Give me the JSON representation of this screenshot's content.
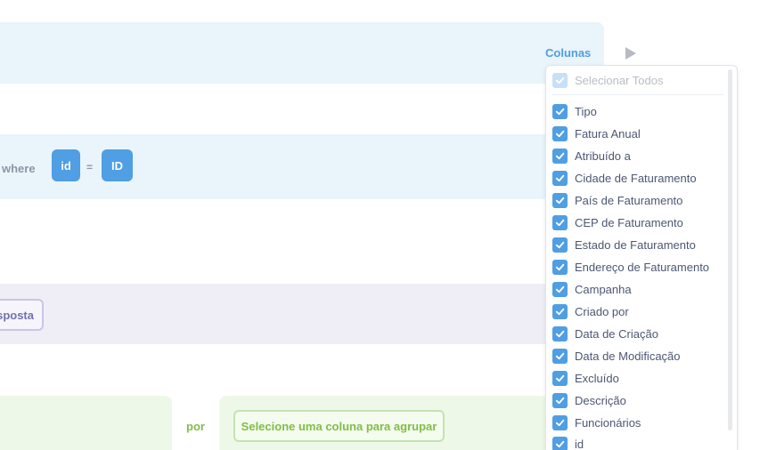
{
  "header": {
    "columns_label": "Colunas"
  },
  "join": {
    "where_label": "where",
    "left_field": "id",
    "operator": "=",
    "right_field": "ID"
  },
  "custom": {
    "partial_label": "sposta"
  },
  "summarize": {
    "by_label": "por",
    "group_placeholder": "Selecione uma coluna para agrupar"
  },
  "column_picker": {
    "select_all_label": "Selecionar Todos",
    "items": [
      {
        "label": "Tipo",
        "checked": true
      },
      {
        "label": "Fatura Anual",
        "checked": true
      },
      {
        "label": "Atribuído a",
        "checked": true
      },
      {
        "label": "Cidade de Faturamento",
        "checked": true
      },
      {
        "label": "País de Faturamento",
        "checked": true
      },
      {
        "label": "CEP de Faturamento",
        "checked": true
      },
      {
        "label": "Estado de Faturamento",
        "checked": true
      },
      {
        "label": "Endereço de Faturamento",
        "checked": true
      },
      {
        "label": "Campanha",
        "checked": true
      },
      {
        "label": "Criado por",
        "checked": true
      },
      {
        "label": "Data de Criação",
        "checked": true
      },
      {
        "label": "Data de Modificação",
        "checked": true
      },
      {
        "label": "Excluído",
        "checked": true
      },
      {
        "label": "Descrição",
        "checked": true
      },
      {
        "label": "Funcionários",
        "checked": true
      },
      {
        "label": "id",
        "checked": true
      }
    ]
  },
  "colors": {
    "accent": "#509ee3",
    "purple": "#7172ad",
    "green": "#84bb4c"
  }
}
